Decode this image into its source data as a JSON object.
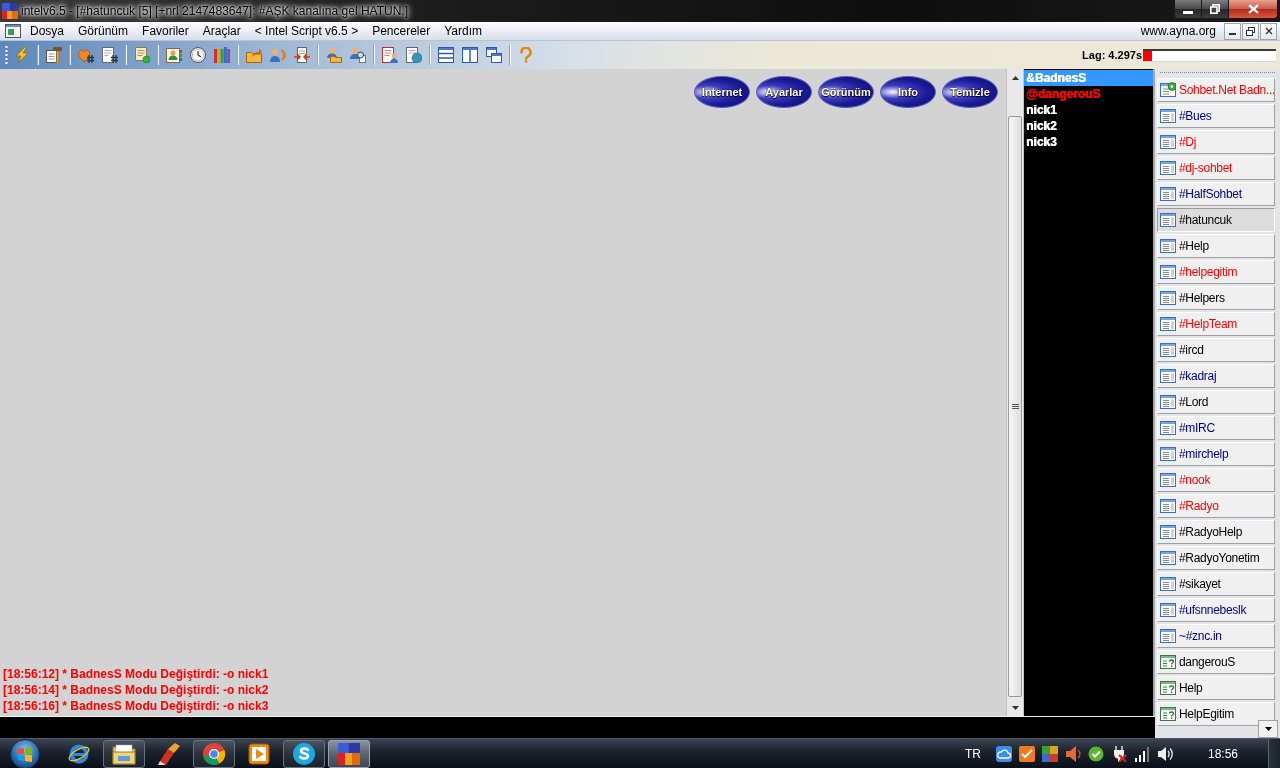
{
  "window": {
    "title": "intelv6.5 - [#hatuncuk [5] [+nrl 2147483647]: #AŞK kanalına gel HATUN.]"
  },
  "menu": {
    "items": [
      "Dosya",
      "Görünüm",
      "Favoriler",
      "Araçlar",
      "< Intel Script v6.5 >",
      "Pencereler",
      "Yardım"
    ],
    "site": "www.ayna.org"
  },
  "toolbar": {
    "lag": {
      "label": "Lag: 4.297s",
      "level": 0.07
    }
  },
  "chat": {
    "buttons": [
      "Internet",
      "Ayarlar",
      "Görünüm",
      "Info",
      "Temizle"
    ],
    "messages": [
      "[18:56:12] * BadnesS Modu Değiştirdi: -o nick1",
      "[18:56:14] * BadnesS Modu Değiştirdi: -o nick2",
      "[18:56:16] * BadnesS Modu Değiştirdi: -o nick3"
    ]
  },
  "nicklist": [
    {
      "nick": "&BadnesS",
      "selected": true
    },
    {
      "nick": "@dangerouS",
      "color": "#ff0000",
      "selected": false
    },
    {
      "nick": "nick1",
      "color": "#ffffff",
      "selected": false
    },
    {
      "nick": "nick2",
      "color": "#ffffff",
      "selected": false
    },
    {
      "nick": "nick3",
      "color": "#ffffff",
      "selected": false
    }
  ],
  "switchbar": [
    {
      "kind": "server",
      "label": "Sohbet.Net Badn...",
      "color": "#ff0000",
      "selected": false
    },
    {
      "kind": "channel",
      "label": "#Bues",
      "color": "#000080",
      "selected": false
    },
    {
      "kind": "channel",
      "label": "#Dj",
      "color": "#ff0000",
      "selected": false
    },
    {
      "kind": "channel",
      "label": "#dj-sohbet",
      "color": "#ff0000",
      "selected": false
    },
    {
      "kind": "channel",
      "label": "#HalfSohbet",
      "color": "#000080",
      "selected": false
    },
    {
      "kind": "channel",
      "label": "#hatuncuk",
      "color": "#000000",
      "selected": true
    },
    {
      "kind": "channel",
      "label": "#Help",
      "color": "#000000",
      "selected": false
    },
    {
      "kind": "channel",
      "label": "#helpegitim",
      "color": "#ff0000",
      "selected": false
    },
    {
      "kind": "channel",
      "label": "#Helpers",
      "color": "#000000",
      "selected": false
    },
    {
      "kind": "channel",
      "label": "#HelpTeam",
      "color": "#ff0000",
      "selected": false
    },
    {
      "kind": "channel",
      "label": "#ircd",
      "color": "#000000",
      "selected": false
    },
    {
      "kind": "channel",
      "label": "#kadraj",
      "color": "#000080",
      "selected": false
    },
    {
      "kind": "channel",
      "label": "#Lord",
      "color": "#000000",
      "selected": false
    },
    {
      "kind": "channel",
      "label": "#mIRC",
      "color": "#000080",
      "selected": false
    },
    {
      "kind": "channel",
      "label": "#mirchelp",
      "color": "#000080",
      "selected": false
    },
    {
      "kind": "channel",
      "label": "#nook",
      "color": "#ff0000",
      "selected": false
    },
    {
      "kind": "channel",
      "label": "#Radyo",
      "color": "#ff0000",
      "selected": false
    },
    {
      "kind": "channel",
      "label": "#RadyoHelp",
      "color": "#000000",
      "selected": false
    },
    {
      "kind": "channel",
      "label": "#RadyoYonetim",
      "color": "#000000",
      "selected": false
    },
    {
      "kind": "channel",
      "label": "#sikayet",
      "color": "#000000",
      "selected": false
    },
    {
      "kind": "channel",
      "label": "#ufsnnebeslk",
      "color": "#000080",
      "selected": false
    },
    {
      "kind": "channel",
      "label": "~#znc.in",
      "color": "#000080",
      "selected": false
    },
    {
      "kind": "query",
      "label": "dangerouS",
      "color": "#000000",
      "selected": false
    },
    {
      "kind": "query",
      "label": "Help",
      "color": "#000000",
      "selected": false
    },
    {
      "kind": "query",
      "label": "HelpEgitim",
      "color": "#000000",
      "selected": false
    }
  ],
  "taskbar": {
    "apps": [
      {
        "running": false,
        "active": false
      },
      {
        "running": true,
        "active": false
      },
      {
        "running": false,
        "active": false
      },
      {
        "running": true,
        "active": false
      },
      {
        "running": false,
        "active": false
      },
      {
        "running": true,
        "active": false
      },
      {
        "running": true,
        "active": true
      }
    ],
    "language": "TR",
    "clock": "18:56"
  }
}
